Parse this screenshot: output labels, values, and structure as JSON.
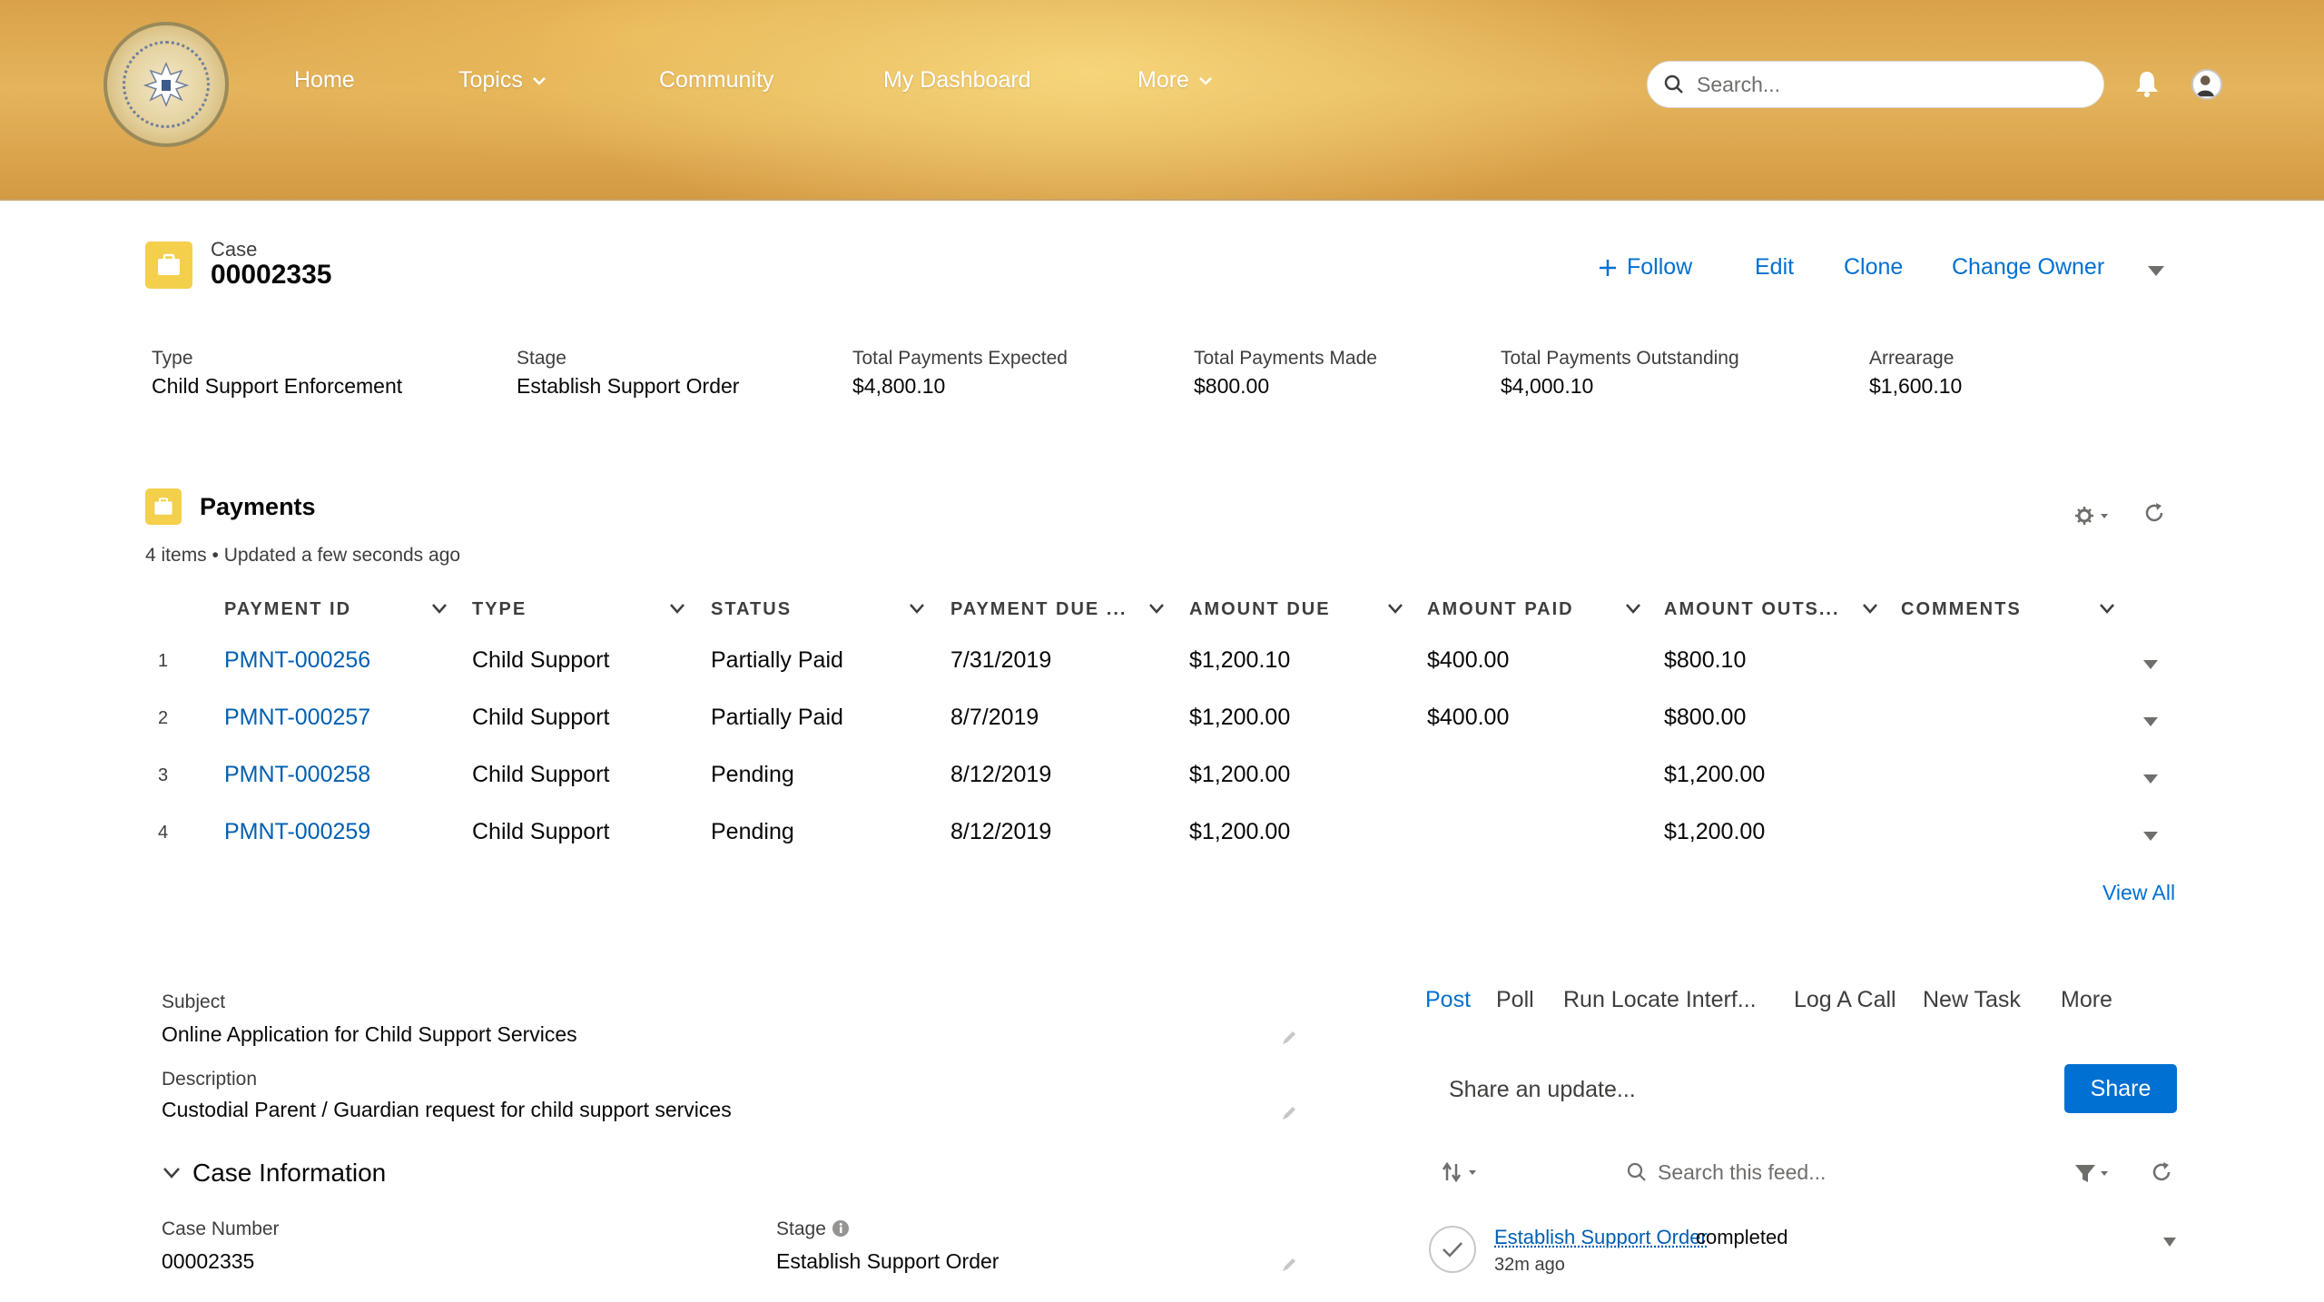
{
  "nav": {
    "home": "Home",
    "topics": "Topics",
    "community": "Community",
    "dashboard": "My Dashboard",
    "more": "More",
    "search_placeholder": "Search..."
  },
  "case": {
    "label": "Case",
    "number": "00002335",
    "actions": {
      "follow": "Follow",
      "edit": "Edit",
      "clone": "Clone",
      "change_owner": "Change Owner"
    }
  },
  "highlights": [
    {
      "label": "Type",
      "value": "Child Support Enforcement"
    },
    {
      "label": "Stage",
      "value": "Establish Support Order"
    },
    {
      "label": "Total Payments Expected",
      "value": "$4,800.10"
    },
    {
      "label": "Total Payments Made",
      "value": "$800.00"
    },
    {
      "label": "Total Payments Outstanding",
      "value": "$4,000.10"
    },
    {
      "label": "Arrearage",
      "value": "$1,600.10"
    }
  ],
  "payments": {
    "title": "Payments",
    "meta": "4 items • Updated a few seconds ago",
    "columns": [
      "PAYMENT ID",
      "TYPE",
      "STATUS",
      "PAYMENT DUE ...",
      "AMOUNT DUE",
      "AMOUNT PAID",
      "AMOUNT OUTS...",
      "COMMENTS"
    ],
    "rows": [
      {
        "num": "1",
        "id": "PMNT-000256",
        "type": "Child Support",
        "status": "Partially Paid",
        "due_date": "7/31/2019",
        "amount_due": "$1,200.10",
        "amount_paid": "$400.00",
        "outstanding": "$800.10",
        "comments": ""
      },
      {
        "num": "2",
        "id": "PMNT-000257",
        "type": "Child Support",
        "status": "Partially Paid",
        "due_date": "8/7/2019",
        "amount_due": "$1,200.00",
        "amount_paid": "$400.00",
        "outstanding": "$800.00",
        "comments": ""
      },
      {
        "num": "3",
        "id": "PMNT-000258",
        "type": "Child Support",
        "status": "Pending",
        "due_date": "8/12/2019",
        "amount_due": "$1,200.00",
        "amount_paid": "",
        "outstanding": "$1,200.00",
        "comments": ""
      },
      {
        "num": "4",
        "id": "PMNT-000259",
        "type": "Child Support",
        "status": "Pending",
        "due_date": "8/12/2019",
        "amount_due": "$1,200.00",
        "amount_paid": "",
        "outstanding": "$1,200.00",
        "comments": ""
      }
    ],
    "view_all": "View All"
  },
  "details": {
    "subject_label": "Subject",
    "subject_value": "Online Application for Child Support Services",
    "description_label": "Description",
    "description_value": "Custodial Parent / Guardian request for child support services",
    "section_title": "Case Information",
    "case_number_label": "Case Number",
    "case_number_value": "00002335",
    "stage_label": "Stage",
    "stage_value": "Establish Support Order"
  },
  "feed": {
    "tabs": [
      "Post",
      "Poll",
      "Run Locate Interf...",
      "Log A Call",
      "New Task",
      "More"
    ],
    "share_placeholder": "Share an update...",
    "share_button": "Share",
    "search_placeholder": "Search this feed...",
    "item_link": "Establish Support Order",
    "item_text": "completed",
    "item_time": "32m ago"
  },
  "colors": {
    "brand": "#0070d2",
    "case_icon": "#f4cf4c"
  }
}
